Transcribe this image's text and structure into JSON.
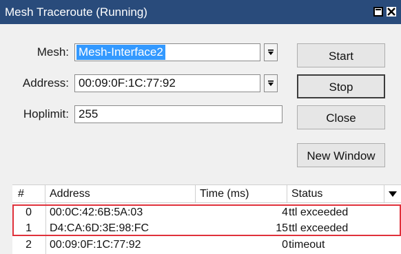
{
  "window": {
    "title": "Mesh Traceroute (Running)"
  },
  "form": {
    "mesh_label": "Mesh:",
    "mesh_value": "Mesh-Interface2",
    "address_label": "Address:",
    "address_value": "00:09:0F:1C:77:92",
    "hoplimit_label": "Hoplimit:",
    "hoplimit_value": "255"
  },
  "buttons": {
    "start": "Start",
    "stop": "Stop",
    "close": "Close",
    "new_window": "New Window"
  },
  "table": {
    "headers": {
      "num": "#",
      "address": "Address",
      "time": "Time (ms)",
      "status": "Status"
    },
    "rows": [
      {
        "num": "0",
        "address": "00:0C:42:6B:5A:03",
        "time": "4",
        "status": "ttl exceeded"
      },
      {
        "num": "1",
        "address": "D4:CA:6D:3E:98:FC",
        "time": "15",
        "status": "ttl exceeded"
      },
      {
        "num": "2",
        "address": "00:09:0F:1C:77:92",
        "time": "0",
        "status": "timeout"
      }
    ]
  },
  "colors": {
    "titlebar": "#294b7b",
    "selection": "#3399ff",
    "highlight_box": "#e0303a"
  },
  "icons": [
    "maximize-icon",
    "close-icon",
    "dropdown-arrow-icon",
    "column-menu-arrow-icon"
  ]
}
